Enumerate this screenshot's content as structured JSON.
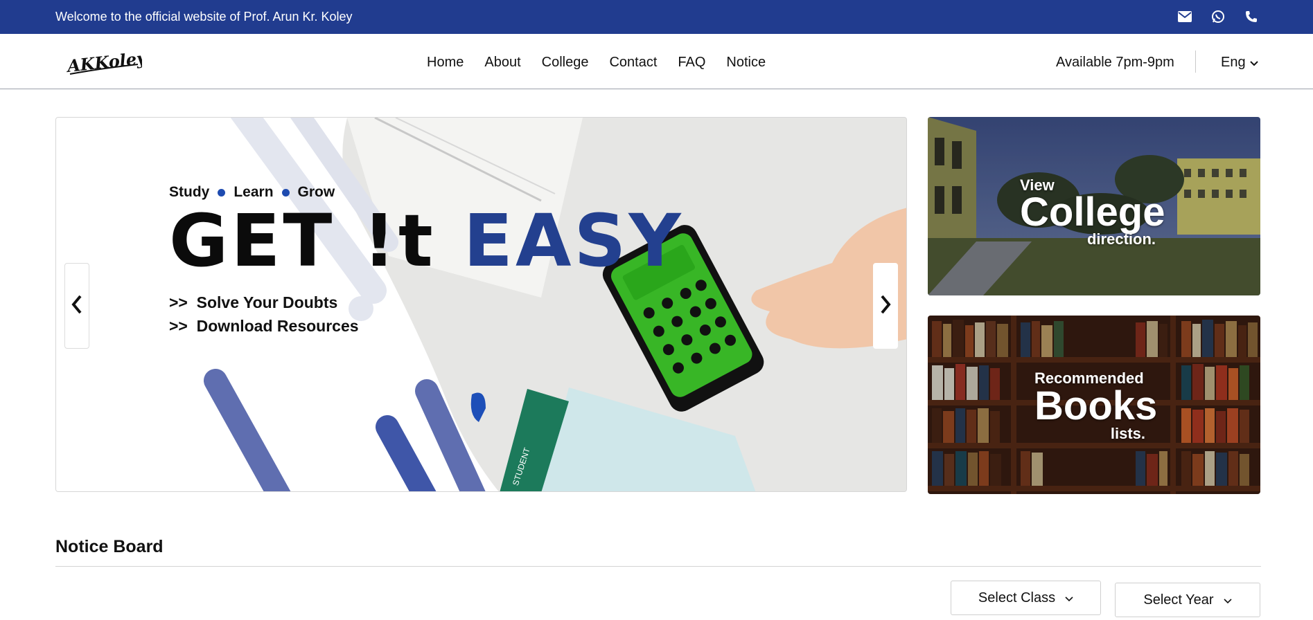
{
  "topbar": {
    "welcome": "Welcome to the official website of Prof. Arun Kr. Koley",
    "icons": [
      "envelope-icon",
      "whatsapp-icon",
      "phone-icon"
    ]
  },
  "nav": {
    "logo_text": "AKKoley",
    "items": [
      "Home",
      "About",
      "College",
      "Contact",
      "FAQ",
      "Notice"
    ],
    "availability": "Available 7pm-9pm",
    "language": "Eng"
  },
  "hero": {
    "tagline": [
      "Study",
      "Learn",
      "Grow"
    ],
    "headline_dark": "GET !t",
    "headline_blue": "EASY",
    "bullets": [
      ">>  Solve Your Doubts",
      ">>  Download Resources"
    ],
    "paper_label": "STUDENT"
  },
  "cards": {
    "college": {
      "pre": "View",
      "big": "College",
      "post": "direction."
    },
    "books": {
      "pre": "Recommended",
      "big": "Books",
      "post": "lists."
    }
  },
  "notice": {
    "title": "Notice Board",
    "select_class": "Select Class",
    "select_year": "Select Year"
  },
  "colors": {
    "brand_blue": "#213c8f",
    "headline_blue": "#23408f",
    "dot_blue": "#1e4bb0",
    "calculator_green": "#3fd42a"
  }
}
